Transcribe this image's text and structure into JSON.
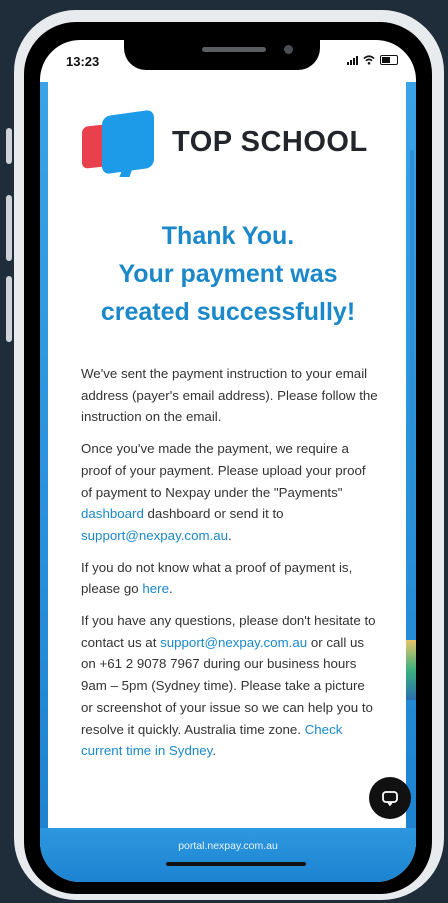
{
  "status": {
    "time": "13:23"
  },
  "logo": {
    "text": "TOP SCHOOL"
  },
  "headline": {
    "line1": "Thank You.",
    "line2": "Your payment was",
    "line3": "created successfully!"
  },
  "paragraphs": {
    "p1": "We've sent the payment instruction to your email address (payer's email address). Please follow the instruction on the email.",
    "p2_part1": "Once you've made the payment, we require a proof of your payment. Please upload your proof of payment to Nexpay under the \"Payments\" ",
    "p2_link1": "dashboard",
    "p2_part2": " dashboard or send it to ",
    "p2_link2": "support@nexpay.com.au",
    "p2_part3": ".",
    "p3_part1": "If you do not know what a proof of payment is, please go ",
    "p3_link": "here",
    "p3_part2": ".",
    "p4_part1": "If you have any questions, please don't hesitate to contact us at ",
    "p4_link1": "support@nexpay.com.au",
    "p4_part2": " or call us on +61 2 9078 7967 during our business hours 9am – 5pm (Sydney time). Please take a picture or screenshot of your issue so we can help you to resolve it quickly. Australia time zone. ",
    "p4_link2": "Check current time in Sydney",
    "p4_part3": "."
  },
  "footer": {
    "url": "portal.nexpay.com.au"
  },
  "icons": {
    "chat": "chat-bubble-icon",
    "signal": "signal-icon",
    "wifi": "wifi-icon",
    "battery": "battery-icon"
  },
  "colors": {
    "accent": "#1a88c9",
    "brand_red": "#e8404d",
    "brand_blue": "#1e9be8",
    "footer": "#2c98df"
  }
}
